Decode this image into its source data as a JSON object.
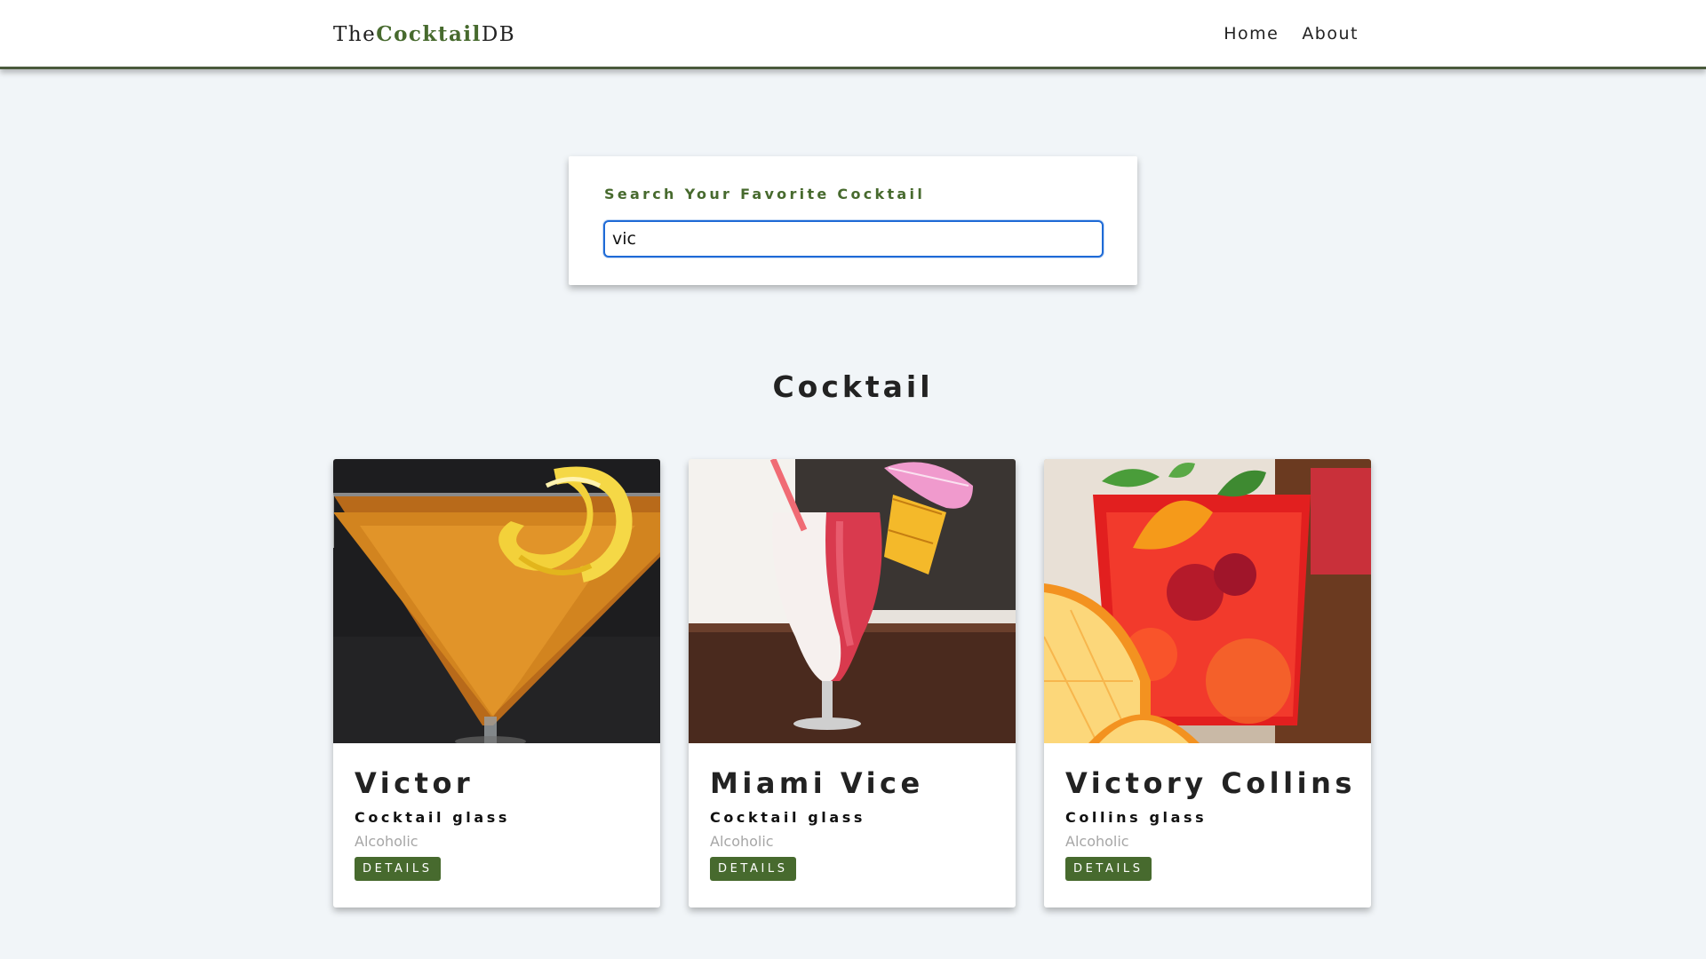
{
  "navbar": {
    "logo_prefix": "The",
    "logo_mid": "Cocktail",
    "logo_suffix": "DB",
    "links": [
      "Home",
      "About"
    ]
  },
  "search": {
    "label": "Search Your Favorite Cocktail",
    "value": "vic"
  },
  "section": {
    "title": "Cocktail"
  },
  "cocktails": [
    {
      "name": "Victor",
      "glass": "Cocktail glass",
      "type": "Alcoholic",
      "button": "DETAILS",
      "image": "martini-lemon-twist"
    },
    {
      "name": "Miami Vice",
      "glass": "Cocktail glass",
      "type": "Alcoholic",
      "button": "DETAILS",
      "image": "frozen-layered-pineapple"
    },
    {
      "name": "Victory Collins",
      "glass": "Collins glass",
      "type": "Alcoholic",
      "button": "DETAILS",
      "image": "red-punch-orange-mint"
    }
  ],
  "colors": {
    "accent": "#476a2e",
    "background": "#f1f5f8",
    "focus": "#1e6ad6"
  }
}
